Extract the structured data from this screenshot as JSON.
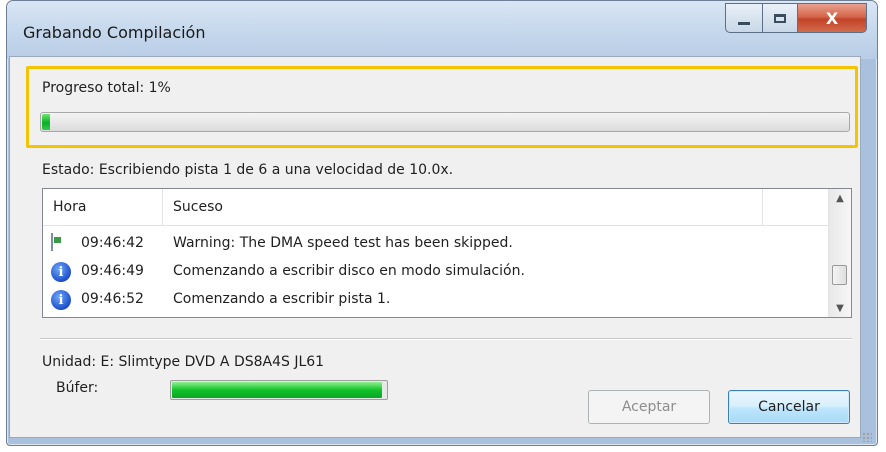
{
  "window": {
    "title": "Grabando Compilación",
    "close_glyph": "X"
  },
  "progress": {
    "label": "Progreso total: 1%",
    "value_percent": 1
  },
  "status": {
    "text": "Estado: Escribiendo pista 1 de 6 a una velocidad de 10.0x."
  },
  "log": {
    "columns": [
      "Hora",
      "Suceso"
    ],
    "rows": [
      {
        "icon": "warning-window-icon",
        "time": "09:46:42",
        "event": "Warning: The DMA speed test has been skipped."
      },
      {
        "icon": "info-icon",
        "time": "09:46:49",
        "event": "Comenzando a escribir disco en modo simulación."
      },
      {
        "icon": "info-icon",
        "time": "09:46:52",
        "event": "Comenzando a escribir pista 1."
      }
    ]
  },
  "device": {
    "label": "Unidad: E: Slimtype DVD A DS8A4S JL61"
  },
  "buffer": {
    "label": "Búfer:",
    "value_percent": 98
  },
  "buttons": {
    "accept": "Aceptar",
    "cancel": "Cancelar"
  },
  "colors": {
    "highlight": "#f5c400",
    "progress_green": "#06b025"
  }
}
